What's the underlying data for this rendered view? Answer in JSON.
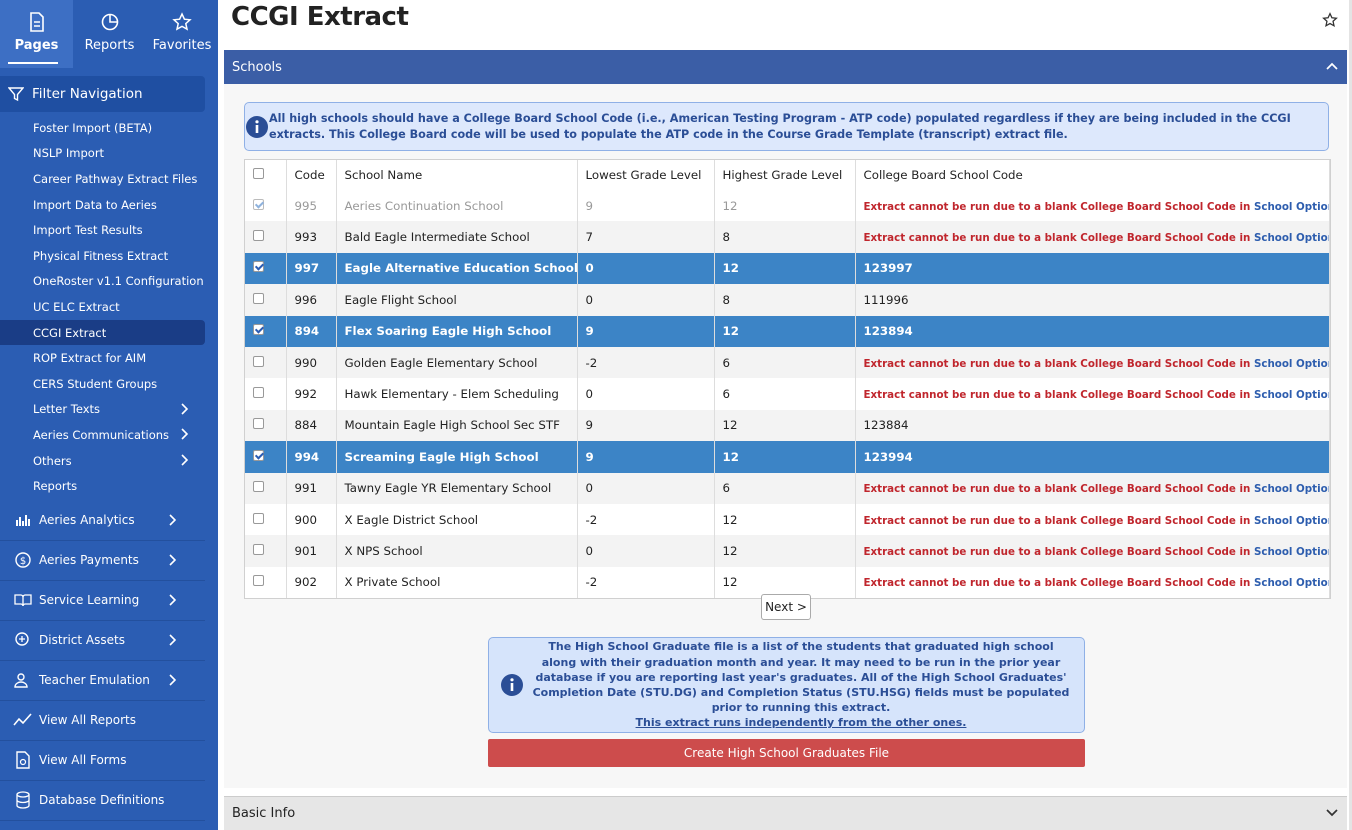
{
  "topnav": {
    "pages": "Pages",
    "reports": "Reports",
    "favorites": "Favorites"
  },
  "filter_nav": "Filter Navigation",
  "sub_items": [
    {
      "label": "Foster Import (BETA)"
    },
    {
      "label": "NSLP Import"
    },
    {
      "label": "Career Pathway Extract Files"
    },
    {
      "label": "Import Data to Aeries"
    },
    {
      "label": "Import Test Results"
    },
    {
      "label": "Physical Fitness Extract"
    },
    {
      "label": "OneRoster v1.1 Configuration"
    },
    {
      "label": "UC ELC Extract"
    },
    {
      "label": "CCGI Extract"
    },
    {
      "label": "ROP Extract for AIM"
    },
    {
      "label": "CERS Student Groups"
    },
    {
      "label": "Letter Texts"
    },
    {
      "label": "Aeries Communications"
    },
    {
      "label": "Others"
    },
    {
      "label": "Reports"
    }
  ],
  "sections": [
    {
      "label": "Aeries Analytics",
      "icon": "bar-chart-icon"
    },
    {
      "label": "Aeries Payments",
      "icon": "dollar-icon"
    },
    {
      "label": "Service Learning",
      "icon": "book-icon"
    },
    {
      "label": "District Assets",
      "icon": "asset-icon"
    },
    {
      "label": "Teacher Emulation",
      "icon": "teacher-icon"
    },
    {
      "label": "View All Reports",
      "icon": "reports-icon"
    },
    {
      "label": "View All Forms",
      "icon": "forms-icon"
    },
    {
      "label": "Database Definitions",
      "icon": "database-icon"
    }
  ],
  "page_title": "CCGI Extract",
  "schools_panel": {
    "title": "Schools",
    "info": "All high schools should have a College Board School Code (i.e., American Testing Program - ATP code) populated regardless if they are being included in the CCGI extracts. This College Board code will be used to populate the ATP code in the Course Grade Template (transcript) extract file.",
    "columns": [
      "Code",
      "School Name",
      "Lowest Grade Level",
      "Highest Grade Level",
      "College Board School Code"
    ],
    "error_prefix": "Extract cannot be run due to a blank College Board School Code in ",
    "error_link": "School Options.",
    "rows": [
      {
        "code": "995",
        "name": "Aeries Continuation School",
        "low": "9",
        "high": "12",
        "cb": "",
        "state": "disabled",
        "checked": true
      },
      {
        "code": "993",
        "name": "Bald Eagle Intermediate School",
        "low": "7",
        "high": "8",
        "cb": "",
        "state": "normal",
        "checked": false
      },
      {
        "code": "997",
        "name": "Eagle Alternative Education School",
        "low": "0",
        "high": "12",
        "cb": "123997",
        "state": "selected",
        "checked": true
      },
      {
        "code": "996",
        "name": "Eagle Flight School",
        "low": "0",
        "high": "8",
        "cb": "111996",
        "state": "normal",
        "checked": false
      },
      {
        "code": "894",
        "name": "Flex Soaring Eagle High School",
        "low": "9",
        "high": "12",
        "cb": "123894",
        "state": "selected",
        "checked": true
      },
      {
        "code": "990",
        "name": "Golden Eagle Elementary School",
        "low": "-2",
        "high": "6",
        "cb": "",
        "state": "normal",
        "checked": false
      },
      {
        "code": "992",
        "name": "Hawk Elementary - Elem Scheduling",
        "low": "0",
        "high": "6",
        "cb": "",
        "state": "normal",
        "checked": false
      },
      {
        "code": "884",
        "name": "Mountain Eagle High School Sec STF",
        "low": "9",
        "high": "12",
        "cb": "123884",
        "state": "normal",
        "checked": false
      },
      {
        "code": "994",
        "name": "Screaming Eagle High School",
        "low": "9",
        "high": "12",
        "cb": "123994",
        "state": "selected",
        "checked": true
      },
      {
        "code": "991",
        "name": "Tawny Eagle YR Elementary School",
        "low": "0",
        "high": "6",
        "cb": "",
        "state": "normal",
        "checked": false
      },
      {
        "code": "900",
        "name": "X Eagle District School",
        "low": "-2",
        "high": "12",
        "cb": "",
        "state": "normal",
        "checked": false
      },
      {
        "code": "901",
        "name": "X NPS School",
        "low": "0",
        "high": "12",
        "cb": "",
        "state": "normal",
        "checked": false
      },
      {
        "code": "902",
        "name": "X Private School",
        "low": "-2",
        "high": "12",
        "cb": "",
        "state": "normal",
        "checked": false
      }
    ],
    "next_label": "Next >",
    "grad_info": "The High School Graduate file is a list of the students that graduated high school along with their graduation month and year. It may need to be run in the prior year database if you are reporting last year's graduates. All of the High School Graduates' Completion Date (STU.DG) and Completion Status (STU.HSG) fields must be populated prior to running this extract.",
    "grad_info_note": "This extract runs independently from the other ones.",
    "create_label": "Create High School Graduates File"
  },
  "basic_info": "Basic Info",
  "colors": {
    "sidebar": "#2b5db3",
    "panel_header": "#3b5ea6",
    "selected_row": "#3c84c6",
    "error_text": "#c0262d",
    "create_button": "#cd4c4c"
  }
}
